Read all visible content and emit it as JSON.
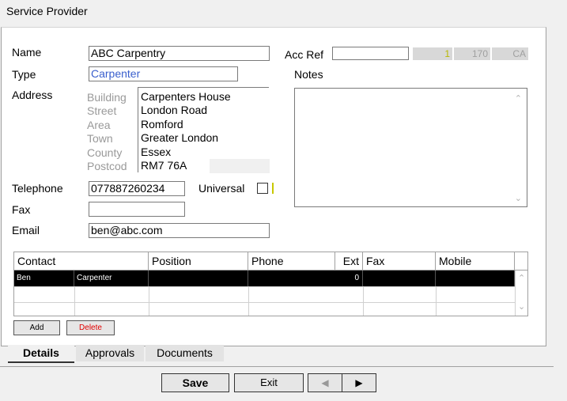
{
  "window": {
    "title": "Service Provider"
  },
  "form": {
    "name_label": "Name",
    "name_value": "ABC Carpentry",
    "type_label": "Type",
    "type_value": "Carpenter",
    "address_label": "Address",
    "address_fields": [
      {
        "label": "Building",
        "value": "Carpenters House"
      },
      {
        "label": "Street",
        "value": "London Road"
      },
      {
        "label": "Area",
        "value": "Romford"
      },
      {
        "label": "Town",
        "value": "Greater London"
      },
      {
        "label": "County",
        "value": "Essex"
      },
      {
        "label": "Postcod",
        "value": "RM7 76A"
      }
    ],
    "telephone_label": "Telephone",
    "telephone_value": "077887260234",
    "universal_label": "Universal",
    "universal_checked": false,
    "fax_label": "Fax",
    "fax_value": "",
    "email_label": "Email",
    "email_value": "ben@abc.com",
    "accref_label": "Acc Ref",
    "accref_value": "",
    "accref_codes": [
      "1",
      "170",
      "CA"
    ],
    "notes_label": "Notes",
    "notes_value": ""
  },
  "contacts": {
    "columns": [
      "Contact",
      "Position",
      "Phone",
      "Ext",
      "Fax",
      "Mobile"
    ],
    "rows": [
      {
        "contact": "Ben",
        "position_text": "Carpenter",
        "position": "",
        "phone": "",
        "ext": "0",
        "fax": "",
        "mobile": ""
      }
    ],
    "add_label": "Add",
    "delete_label": "Delete"
  },
  "tabs": [
    {
      "label": "Details",
      "active": true
    },
    {
      "label": "Approvals",
      "active": false
    },
    {
      "label": "Documents",
      "active": false
    }
  ],
  "footer": {
    "save_label": "Save",
    "exit_label": "Exit",
    "prev_icon": "left-arrow-icon",
    "next_icon": "right-arrow-icon"
  },
  "colors": {
    "type_link": "#3a5fcd",
    "delete_text": "#e00000",
    "selected_row": "#000000"
  }
}
